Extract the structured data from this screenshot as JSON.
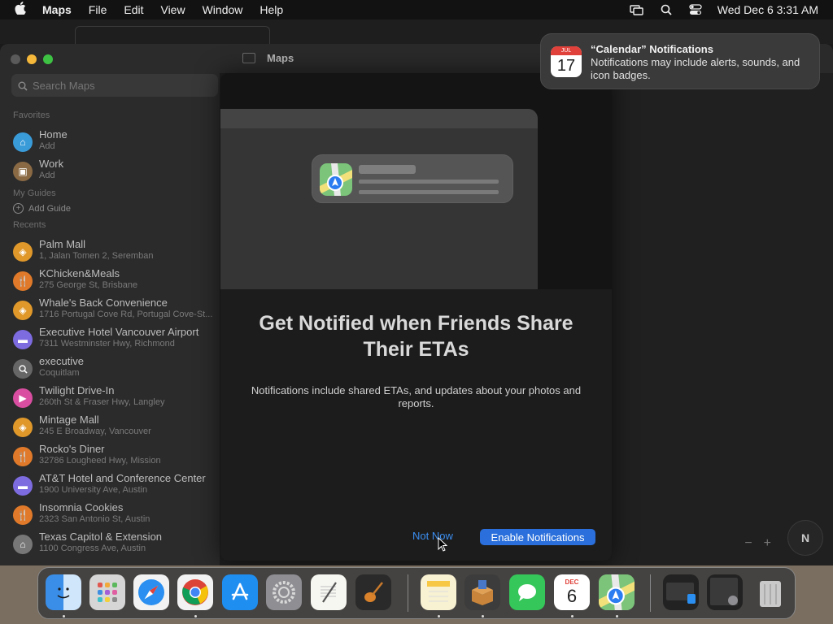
{
  "menubar": {
    "app": "Maps",
    "items": [
      "File",
      "Edit",
      "View",
      "Window",
      "Help"
    ],
    "datetime": "Wed Dec 6  3:31 AM"
  },
  "window": {
    "title": "Maps"
  },
  "search": {
    "placeholder": "Search Maps"
  },
  "sidebar": {
    "favorites_header": "Favorites",
    "favorites": [
      {
        "name": "Home",
        "sub": "Add",
        "color": "#3a9bd9",
        "icon": "house-icon"
      },
      {
        "name": "Work",
        "sub": "Add",
        "color": "#8a6a44",
        "icon": "briefcase-icon"
      }
    ],
    "guides_header": "My Guides",
    "add_guide": "Add Guide",
    "recents_header": "Recents",
    "recents": [
      {
        "name": "Palm Mall",
        "sub": "1, Jalan Tomen 2, Seremban",
        "color": "#e0982a",
        "icon": "bag-icon"
      },
      {
        "name": "KChicken&Meals",
        "sub": "275 George St, Brisbane",
        "color": "#e07a2a",
        "icon": "fork-knife-icon"
      },
      {
        "name": "Whale's Back Convenience",
        "sub": "1716 Portugal Cove Rd, Portugal Cove-St...",
        "color": "#e0982a",
        "icon": "bag-icon"
      },
      {
        "name": "Executive Hotel Vancouver Airport",
        "sub": "7311 Westminster Hwy, Richmond",
        "color": "#7d6be0",
        "icon": "bed-icon"
      },
      {
        "name": "executive",
        "sub": "Coquitlam",
        "color": "#666666",
        "icon": "magnifier-icon"
      },
      {
        "name": "Twilight Drive-In",
        "sub": "260th St & Fraser Hwy, Langley",
        "color": "#d94ea0",
        "icon": "film-icon"
      },
      {
        "name": "Mintage Mall",
        "sub": "245 E Broadway, Vancouver",
        "color": "#e0982a",
        "icon": "bag-icon"
      },
      {
        "name": "Rocko's Diner",
        "sub": "32786 Lougheed Hwy, Mission",
        "color": "#e07a2a",
        "icon": "fork-knife-icon"
      },
      {
        "name": "AT&T Hotel and Conference Center",
        "sub": "1900 University Ave, Austin",
        "color": "#7d6be0",
        "icon": "bed-icon"
      },
      {
        "name": "Insomnia Cookies",
        "sub": "2323 San Antonio St, Austin",
        "color": "#e07a2a",
        "icon": "fork-knife-icon"
      },
      {
        "name": "Texas Capitol & Extension",
        "sub": "1100 Congress Ave, Austin",
        "color": "#777777",
        "icon": "landmark-icon"
      }
    ]
  },
  "dialog": {
    "title": "Get Notified when Friends Share Their ETAs",
    "description": "Notifications include shared ETAs, and updates about your photos and reports.",
    "not_now": "Not Now",
    "enable": "Enable Notifications"
  },
  "banner": {
    "month": "JUL",
    "day": "17",
    "title": "“Calendar” Notifications",
    "body": "Notifications may include alerts, sounds, and icon badges."
  },
  "map": {
    "compass": "N",
    "zoom_out": "−",
    "zoom_in": "+"
  },
  "dock": {
    "calendar_month": "DEC",
    "calendar_day": "6"
  }
}
